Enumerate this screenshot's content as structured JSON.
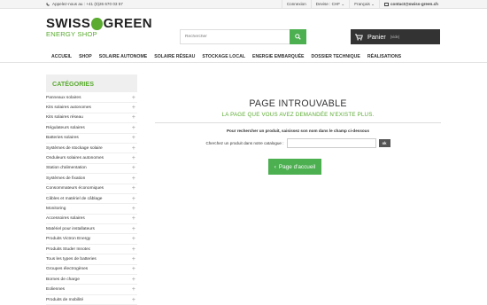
{
  "topbar": {
    "phone_text": "Appelez-nous au : +41 (0)26 670 03 57",
    "connexion": "Connexion",
    "devise": "Devise : CHF ⌄",
    "langue": "Français ⌄",
    "email": "contact@swiss-green.ch"
  },
  "logo": {
    "word1": "SWISS",
    "word2": "GREEN",
    "tagline": "ENERGY SHOP",
    "brand_color": "#5aab30"
  },
  "search": {
    "placeholder": "Rechercher"
  },
  "cart": {
    "label": "Panier",
    "status": "(vide)"
  },
  "nav": {
    "items": [
      "ACCUEIL",
      "SHOP",
      "SOLAIRE AUTONOME",
      "SOLAIRE RÉSEAU",
      "STOCKAGE LOCAL",
      "ENERGIE EMBARQUÉE",
      "DOSSIER TECHNIQUE",
      "RÉALISATIONS"
    ]
  },
  "sidebar": {
    "title": "CATÉGORIES",
    "categories": [
      "Panneaux solaires",
      "Kits solaires autonomes",
      "Kits solaires réseau",
      "Régulateurs solaires",
      "Batteries solaires",
      "Systèmes de stockage solaire",
      "Onduleurs solaires autonomes",
      "Station d'alimentation",
      "Systèmes de fixation",
      "Consommateurs économiques",
      "Câbles et matériel de câblage",
      "Monitoring",
      "Accessoires solaires",
      "Matériel pour installateurs",
      "Produits Victron Energy",
      "Produits Studer Innotec",
      "Tous les types de batteries",
      "Groupes électrogènes",
      "Bornes de charge",
      "Eoliennes",
      "Produits de mobilité"
    ]
  },
  "main": {
    "title": "PAGE INTROUVABLE",
    "subtitle": "LA PAGE QUE VOUS AVEZ DEMANDÉE N'EXISTE PLUS.",
    "instruction": "Pour rechercher un produit, saisissez son nom dans le champ ci-dessous",
    "search_label": "Cherchez un produit dans notre catalogue :",
    "ok_label": "ok",
    "home_button": "Page d'accueil"
  }
}
